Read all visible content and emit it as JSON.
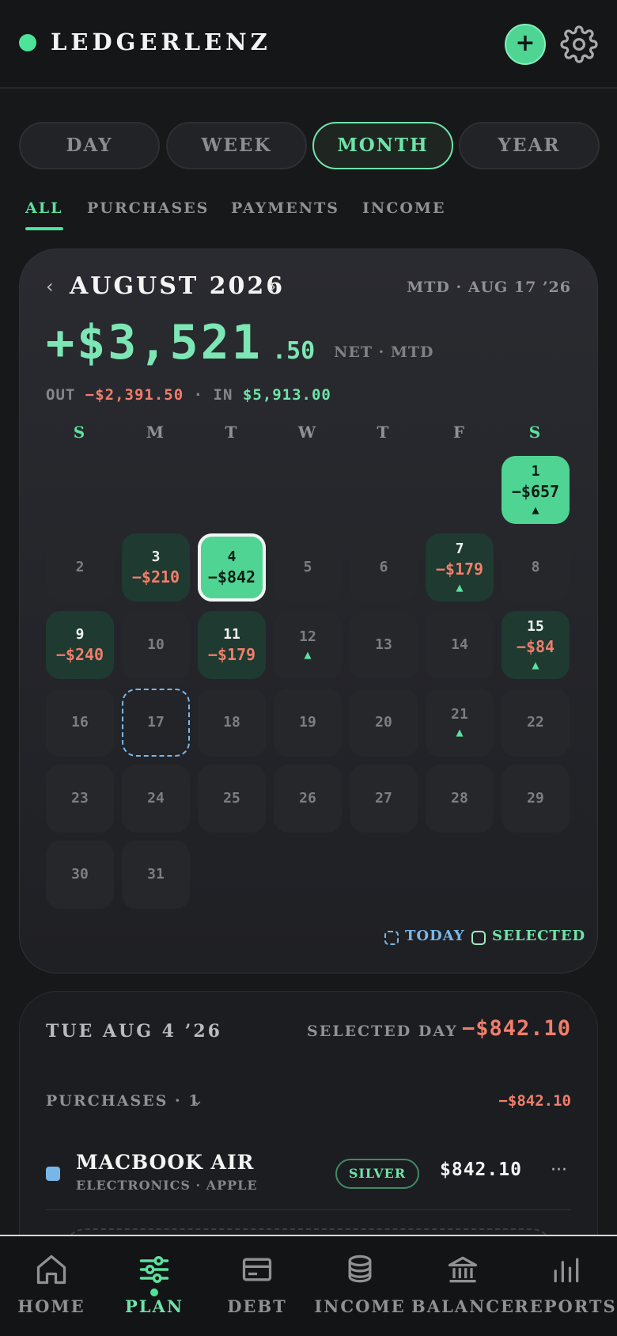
{
  "app": {
    "name": "LEDGERLENZ",
    "accent": "#4ee39a"
  },
  "header": {
    "add_label": "+",
    "settings_icon": "gear-icon"
  },
  "periods": [
    "DAY",
    "WEEK",
    "MONTH",
    "YEAR"
  ],
  "active_period": "MONTH",
  "filters": [
    "ALL",
    "PURCHASES",
    "PAYMENTS",
    "INCOME"
  ],
  "active_filter": "ALL",
  "calendar": {
    "prev": "‹",
    "next": "›",
    "month": "AUGUST 2026",
    "mtd_label": "MTD · AUG 17 ’26",
    "net_main": "+$3,521",
    "net_cents": ".50",
    "net_label": "NET · MTD",
    "out_label": "OUT",
    "out_value": "−$2,391.50",
    "sep": "·",
    "in_label": "IN",
    "in_value": "$5,913.00",
    "weekdays": [
      "S",
      "M",
      "T",
      "W",
      "T",
      "F",
      "S"
    ],
    "days": {
      "1": {
        "d": "1",
        "a": "−$657",
        "m": "▲",
        "state": "big"
      },
      "2": {
        "d": "2"
      },
      "3": {
        "d": "3",
        "a": "−$210",
        "state": "spend"
      },
      "4": {
        "d": "4",
        "a": "−$842",
        "state": "big selected"
      },
      "5": {
        "d": "5"
      },
      "6": {
        "d": "6"
      },
      "7": {
        "d": "7",
        "a": "−$179",
        "m": "▲",
        "state": "spend"
      },
      "8": {
        "d": "8"
      },
      "9": {
        "d": "9",
        "a": "−$240",
        "state": "spend"
      },
      "10": {
        "d": "10"
      },
      "11": {
        "d": "11",
        "a": "−$179",
        "state": "spend"
      },
      "12": {
        "d": "12",
        "m": "▲"
      },
      "13": {
        "d": "13"
      },
      "14": {
        "d": "14"
      },
      "15": {
        "d": "15",
        "a": "−$84",
        "m": "▲",
        "state": "spend"
      },
      "16": {
        "d": "16"
      },
      "17": {
        "d": "17",
        "state": "today"
      },
      "18": {
        "d": "18"
      },
      "19": {
        "d": "19"
      },
      "20": {
        "d": "20"
      },
      "21": {
        "d": "21",
        "m": "▲"
      },
      "22": {
        "d": "22"
      },
      "23": {
        "d": "23"
      },
      "24": {
        "d": "24"
      },
      "25": {
        "d": "25"
      },
      "26": {
        "d": "26"
      },
      "27": {
        "d": "27"
      },
      "28": {
        "d": "28"
      },
      "29": {
        "d": "29"
      },
      "30": {
        "d": "30"
      },
      "31": {
        "d": "31"
      }
    },
    "legend_today": "TODAY",
    "legend_selected": "SELECTED"
  },
  "selected_day": {
    "title": "TUE AUG 4 ’26",
    "label": "SELECTED DAY",
    "amount": "−$842.10",
    "group_label": "PURCHASES · 1",
    "group_chevron": "⌄",
    "group_amount": "−$842.10",
    "item": {
      "name": "MACBOOK AIR",
      "category": "ELECTRONICS",
      "sep": "·",
      "merchant": "APPLE",
      "badge": "SILVER",
      "amount": "$842.10",
      "more": "···",
      "color": "#79b6e8"
    }
  },
  "nav": {
    "items": [
      {
        "label": "HOME",
        "icon": "home-icon"
      },
      {
        "label": "PLAN",
        "icon": "sliders-icon"
      },
      {
        "label": "DEBT",
        "icon": "card-icon"
      },
      {
        "label": "INCOME",
        "icon": "coins-icon"
      },
      {
        "label": "BALANCE",
        "icon": "bank-icon"
      },
      {
        "label": "REPORTS",
        "icon": "bar-chart-icon"
      }
    ],
    "active": "PLAN"
  }
}
